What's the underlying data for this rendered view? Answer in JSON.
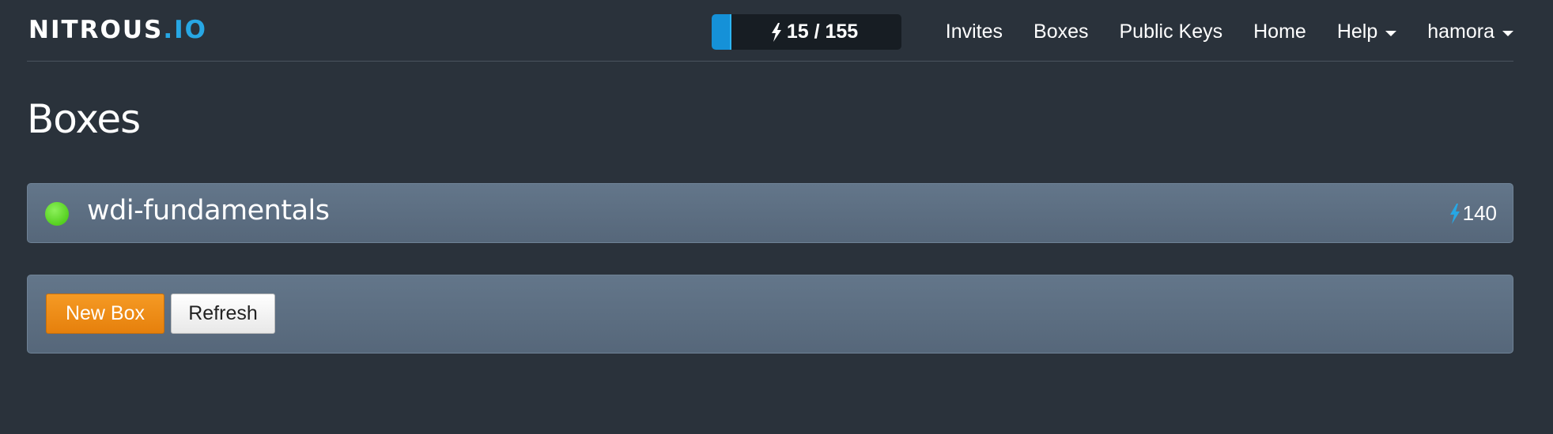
{
  "brand": {
    "logo_main": "NITROUS",
    "logo_suffix": ".IO"
  },
  "power": {
    "label": "15 / 155",
    "used": 15,
    "total": 155,
    "fill_fraction": 0.0968,
    "bolt_icon": "lightning-bolt-icon",
    "fill_color": "#1591d8"
  },
  "nav": {
    "invites": "Invites",
    "boxes": "Boxes",
    "public_keys": "Public Keys",
    "home": "Home",
    "help": "Help",
    "user": "hamora"
  },
  "page": {
    "title": "Boxes"
  },
  "boxes": [
    {
      "name": "wdi-fundamentals",
      "status": "running",
      "status_color": "#6fe03a",
      "cost": "140"
    }
  ],
  "actions": {
    "new_box": "New Box",
    "refresh": "Refresh"
  },
  "colors": {
    "background": "#2a323b",
    "accent_blue": "#27a7e4",
    "new_box_orange": "#f0901a"
  }
}
